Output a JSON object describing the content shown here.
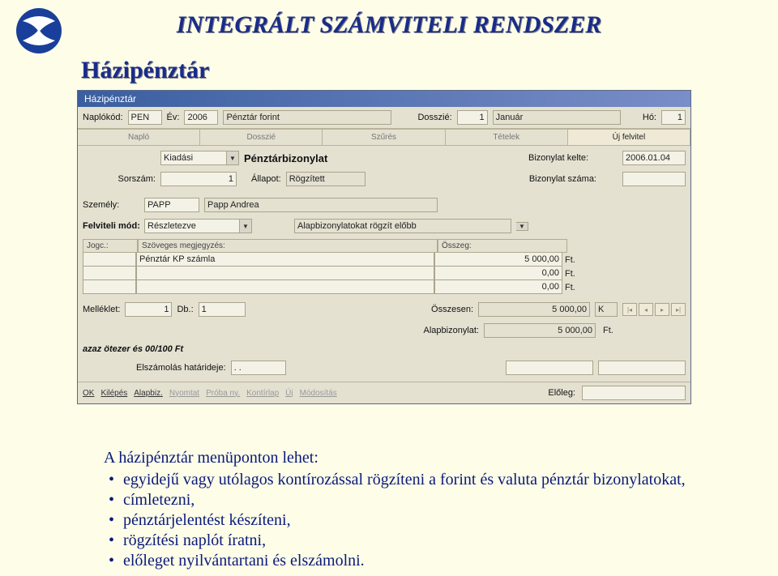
{
  "page": {
    "main_title": "INTEGRÁLT SZÁMVITELI RENDSZER",
    "sub_title": "Házipénztár"
  },
  "window": {
    "title": "Házipénztár",
    "header": {
      "naplokod_label": "Naplókód:",
      "naplokod_value": "PEN",
      "ev_label": "Év:",
      "ev_value": "2006",
      "penztar_label": "Pénztár forint",
      "dosszie_label": "Dosszié:",
      "dosszie_value": "1",
      "honapnev": "Január",
      "ho_label": "Hó:",
      "ho_value": "1"
    },
    "tabs": [
      "Napló",
      "Dosszié",
      "Szűrés",
      "Tételek",
      "Új felvitel"
    ],
    "form": {
      "kiadasi": "Kiadási",
      "penztarbizonylat": "Pénztárbizonylat",
      "biz_kelte_label": "Bizonylat kelte:",
      "biz_kelte_value": "2006.01.04",
      "sorszam_label": "Sorszám:",
      "sorszam_value": "1",
      "allapot_label": "Állapot:",
      "allapot_value": "Rögzített",
      "biz_szama_label": "Bizonylat száma:",
      "biz_szama_value": "",
      "szemely_label": "Személy:",
      "szemely_code": "PAPP",
      "szemely_name": "Papp Andrea",
      "felviteli_label": "Felviteli mód:",
      "felviteli_value": "Részletezve",
      "felviteli_note": "Alapbizonylatokat rögzít előbb",
      "cols": {
        "jogc": "Jogc.:",
        "szoveg": "Szöveges megjegyzés:",
        "osszeg": "Összeg:"
      },
      "rows": [
        {
          "jogc": "",
          "szoveg": "Pénztár KP számla",
          "osszeg": "5 000,00",
          "unit": "Ft."
        },
        {
          "jogc": "",
          "szoveg": "",
          "osszeg": "0,00",
          "unit": "Ft."
        },
        {
          "jogc": "",
          "szoveg": "",
          "osszeg": "0,00",
          "unit": "Ft."
        }
      ],
      "melleklet_label": "Melléklet:",
      "melleklet_value": "1",
      "db_label": "Db.:",
      "db_value": "1",
      "osszesen_label": "Összesen:",
      "osszesen_value": "5 000,00",
      "osszesen_unit": "K",
      "alapbiz_label": "Alapbizonylat:",
      "alapbiz_value": "5 000,00",
      "alapbiz_unit": "Ft.",
      "azaz": "azaz ötezer és 00/100 Ft",
      "elsz_label": "Elszámolás határideje:",
      "elsz_value": ". ."
    },
    "footer": {
      "ok": "OK",
      "kilepes": "Kilépés",
      "alapbiz": "Alapbiz.",
      "nyomtat": "Nyomtat",
      "probany": "Próba ny.",
      "kontirlap": "Kontírlap",
      "uj": "Új",
      "modositas": "Módosítás",
      "eloleg": "Előleg:"
    }
  },
  "desc": {
    "intro": "A házipénztár menüponton lehet:",
    "bullets": [
      "egyidejű vagy utólagos kontírozással rögzíteni a forint és valuta pénztár bizonylatokat,",
      "címletezni,",
      "pénztárjelentést készíteni,",
      "rögzítési naplót íratni,",
      "előleget nyilvántartani és elszámolni."
    ]
  }
}
